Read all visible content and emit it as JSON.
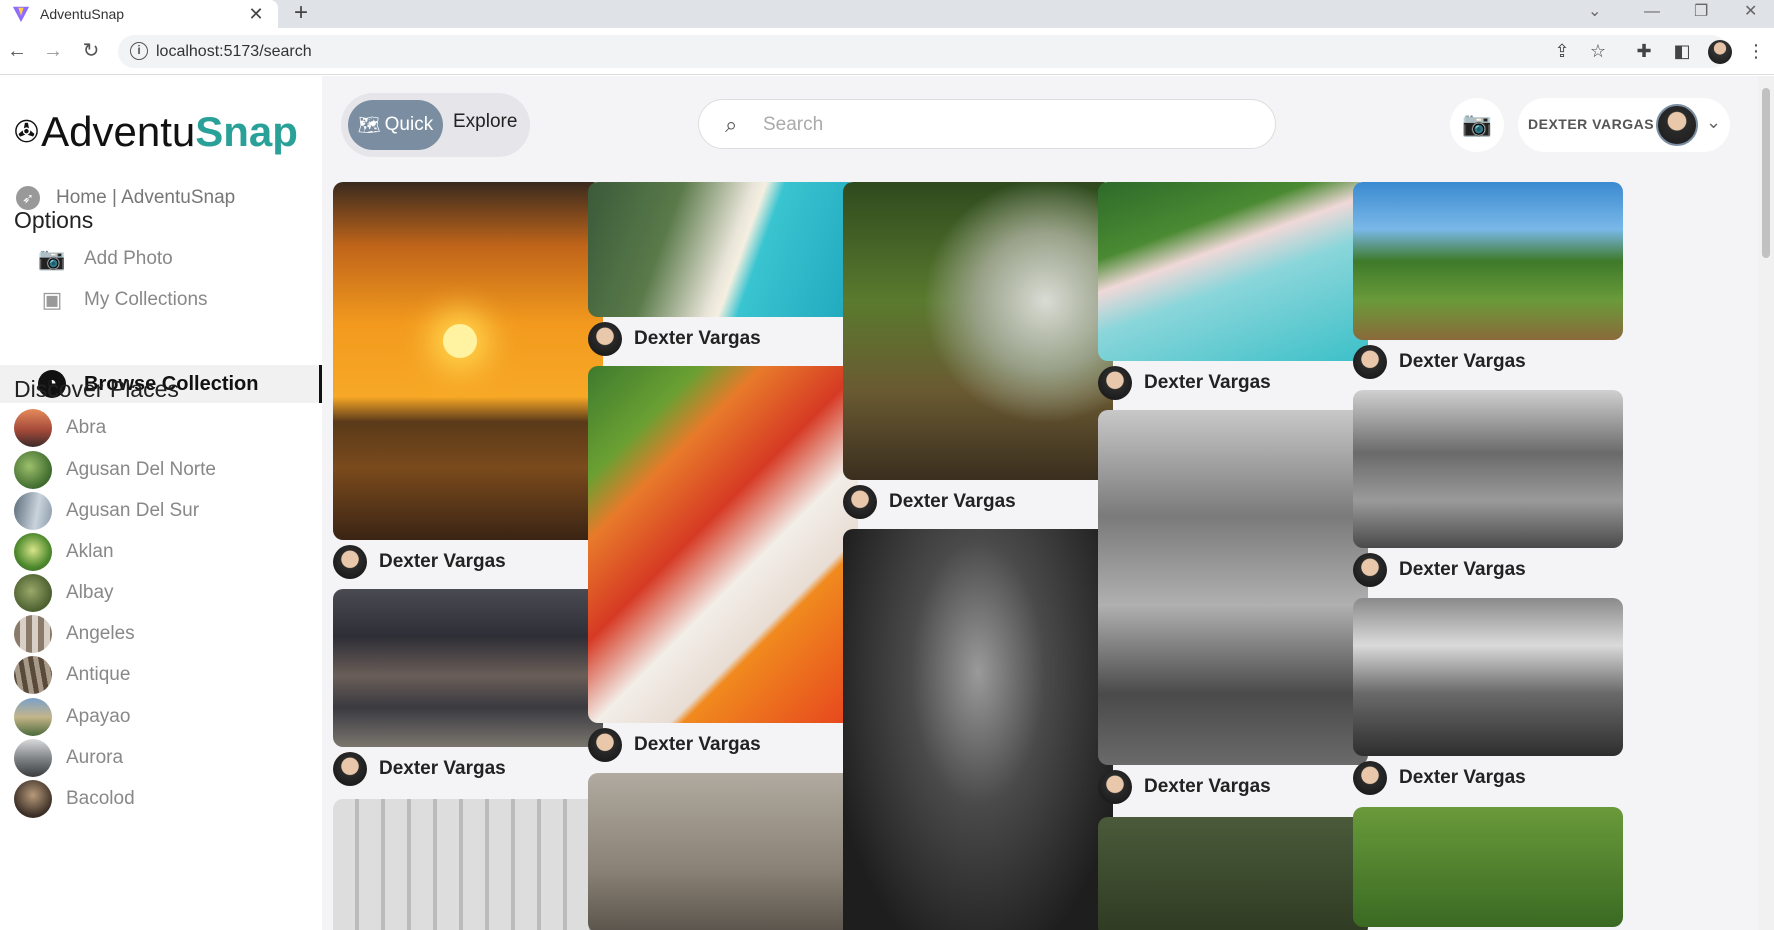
{
  "browser": {
    "tab_title": "AdventuSnap",
    "url": "localhost:5173/search"
  },
  "app": {
    "logo_prefix": "AdventuSnap",
    "logo_part1": "Adventu",
    "logo_part2": "Snap",
    "accent": "#2aa198"
  },
  "sidebar": {
    "home_label": "Home | AdventuSnap",
    "options_heading": "Options",
    "options": [
      {
        "label": "Add Photo",
        "icon": "add-photo-icon"
      },
      {
        "label": "My Collections",
        "icon": "collections-icon"
      },
      {
        "label": "Browse Collection",
        "icon": "browse-icon",
        "active": true
      }
    ],
    "discover_heading": "Discover Places",
    "places": [
      "Abra",
      "Agusan Del Norte",
      "Agusan Del Sur",
      "Aklan",
      "Albay",
      "Angeles",
      "Antique",
      "Apayao",
      "Aurora",
      "Bacolod"
    ]
  },
  "topbar": {
    "quick_label": "Quick",
    "explore_label": "Explore",
    "search_placeholder": "Search",
    "user_name": "DEXTER VARGAS"
  },
  "feed": {
    "author": "Dexter Vargas",
    "cards": [
      {
        "subject": "sunset kayaker"
      },
      {
        "subject": "group photo"
      },
      {
        "subject": "beach aerial"
      },
      {
        "subject": "vegetables"
      },
      {
        "subject": "man making fire"
      },
      {
        "subject": "train interior"
      },
      {
        "subject": "pink beach aerial"
      },
      {
        "subject": "jeepney driver"
      },
      {
        "subject": "carabao rider"
      },
      {
        "subject": "market street"
      },
      {
        "subject": "market vendor"
      }
    ]
  }
}
